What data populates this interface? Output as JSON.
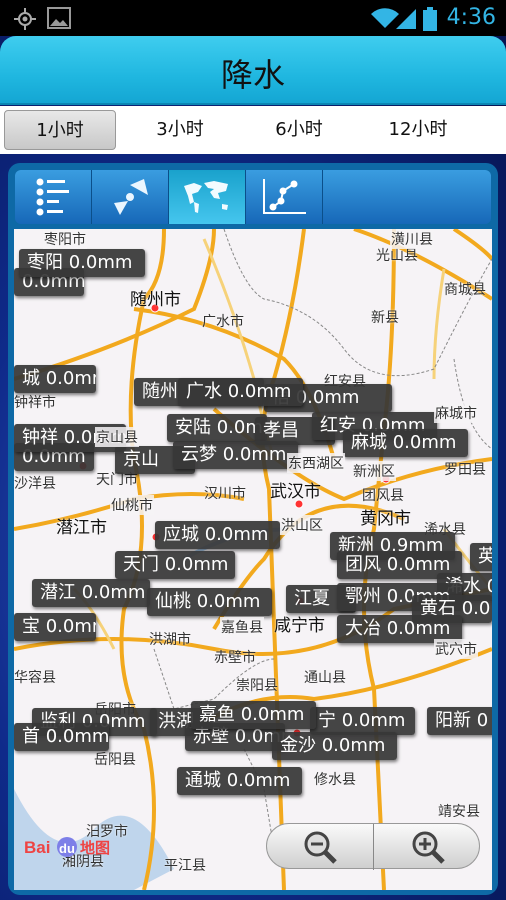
{
  "status_bar": {
    "time": "4:36",
    "icons": [
      "gps-icon",
      "image-icon",
      "wifi-icon",
      "signal-icon",
      "battery-icon"
    ]
  },
  "header": {
    "title": "降水"
  },
  "time_tabs": [
    {
      "label": "1小时",
      "selected": true
    },
    {
      "label": "3小时",
      "selected": false
    },
    {
      "label": "6小时",
      "selected": false
    },
    {
      "label": "12小时",
      "selected": false
    }
  ],
  "toolbar": {
    "buttons": [
      "list-icon",
      "radar-icon",
      "world-map-icon",
      "line-chart-icon"
    ],
    "selected": "world-map-icon"
  },
  "map": {
    "cities": [
      "随州市",
      "广水市",
      "光山县",
      "商城县",
      "新县",
      "红安县",
      "麻城市",
      "罗田县",
      "团风县",
      "黄冈市",
      "浠水县",
      "武汉市",
      "汉川市",
      "新洲区",
      "东西湖区",
      "洪山区",
      "京山县",
      "天门市",
      "沙洋县",
      "钟祥市",
      "潜江市",
      "仙桃市",
      "洪湖市",
      "赤壁市",
      "咸宁市",
      "崇阳县",
      "通山县",
      "修水县",
      "靖安县",
      "平江县",
      "汨罗市",
      "湘阴县",
      "岳阳市",
      "岳阳县",
      "华容县",
      "嘉鱼县",
      "枣阳市",
      "潢川县",
      "武穴市"
    ],
    "callouts": [
      "0.0mm",
      "枣阳 0.0mm",
      "城 0.0mm",
      "钟祥 0.0mm",
      "0.0mm",
      "随州",
      "悟 0.0mm",
      "广水 0.0mm",
      "安陆 0.0mm",
      "孝昌",
      "红安 0.0mm",
      "麻城 0.0mm",
      "京山",
      "云梦 0.0mm",
      "新洲 0.9mm",
      "应城 0.0mm",
      "天门 0.0mm",
      "团风 0.0mm",
      "英",
      "潜江 0.0mm",
      "仙桃 0.0mm",
      "浠水 0",
      "江夏",
      "鄂州 0.0mm",
      "黄石 0.0",
      "宝 0.0mm",
      "大冶 0.0mm",
      "阳新 0",
      "监利 0.0mm",
      "洪湖",
      "首 0.0mm",
      "嘉鱼 0.0mm",
      "宁 0.0mm",
      "赤壁 0.0mm",
      "金沙 0.0mm",
      "通城 0.0mm"
    ],
    "logo": "Bai du 地图",
    "zoom_controls": [
      "zoom-out-icon",
      "zoom-in-icon"
    ]
  }
}
